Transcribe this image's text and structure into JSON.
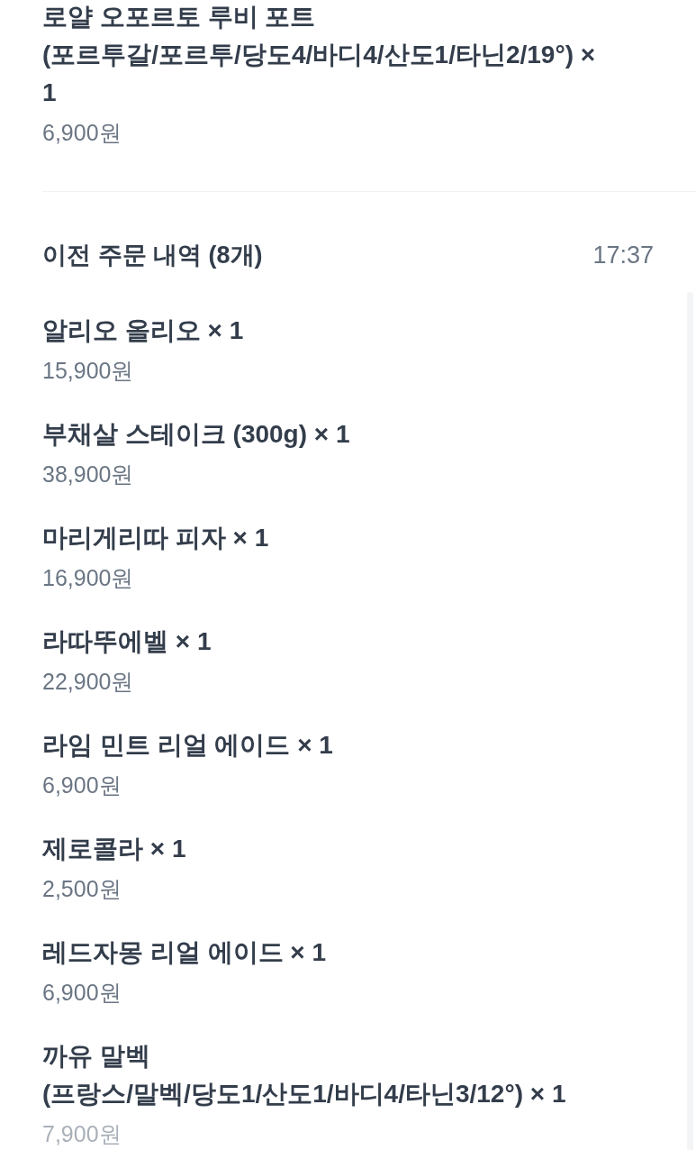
{
  "order_items": [
    {
      "name": "로얄 오포르토 루비 포트 (포르투갈/포르투/당도4/바디4/산도1/타닌2/19°) × 1",
      "price": "6,900원"
    }
  ],
  "previous_orders": {
    "title": "이전 주문 내역 (8개)",
    "time": "17:37",
    "items": [
      {
        "name": "알리오 올리오 × 1",
        "price": "15,900원"
      },
      {
        "name": "부채살 스테이크 (300g) × 1",
        "price": "38,900원"
      },
      {
        "name": "마리게리따 피자 × 1",
        "price": "16,900원"
      },
      {
        "name": "라따뚜에벨 × 1",
        "price": "22,900원"
      },
      {
        "name": "라임 민트 리얼 에이드 × 1",
        "price": "6,900원"
      },
      {
        "name": "제로콜라 × 1",
        "price": "2,500원"
      },
      {
        "name": "레드자몽 리얼 에이드 × 1",
        "price": "6,900원"
      },
      {
        "name": "까유 말벡 (프랑스/말벡/당도1/산도1/바디4/타닌3/12°) × 1",
        "price": "7,900원"
      }
    ]
  }
}
